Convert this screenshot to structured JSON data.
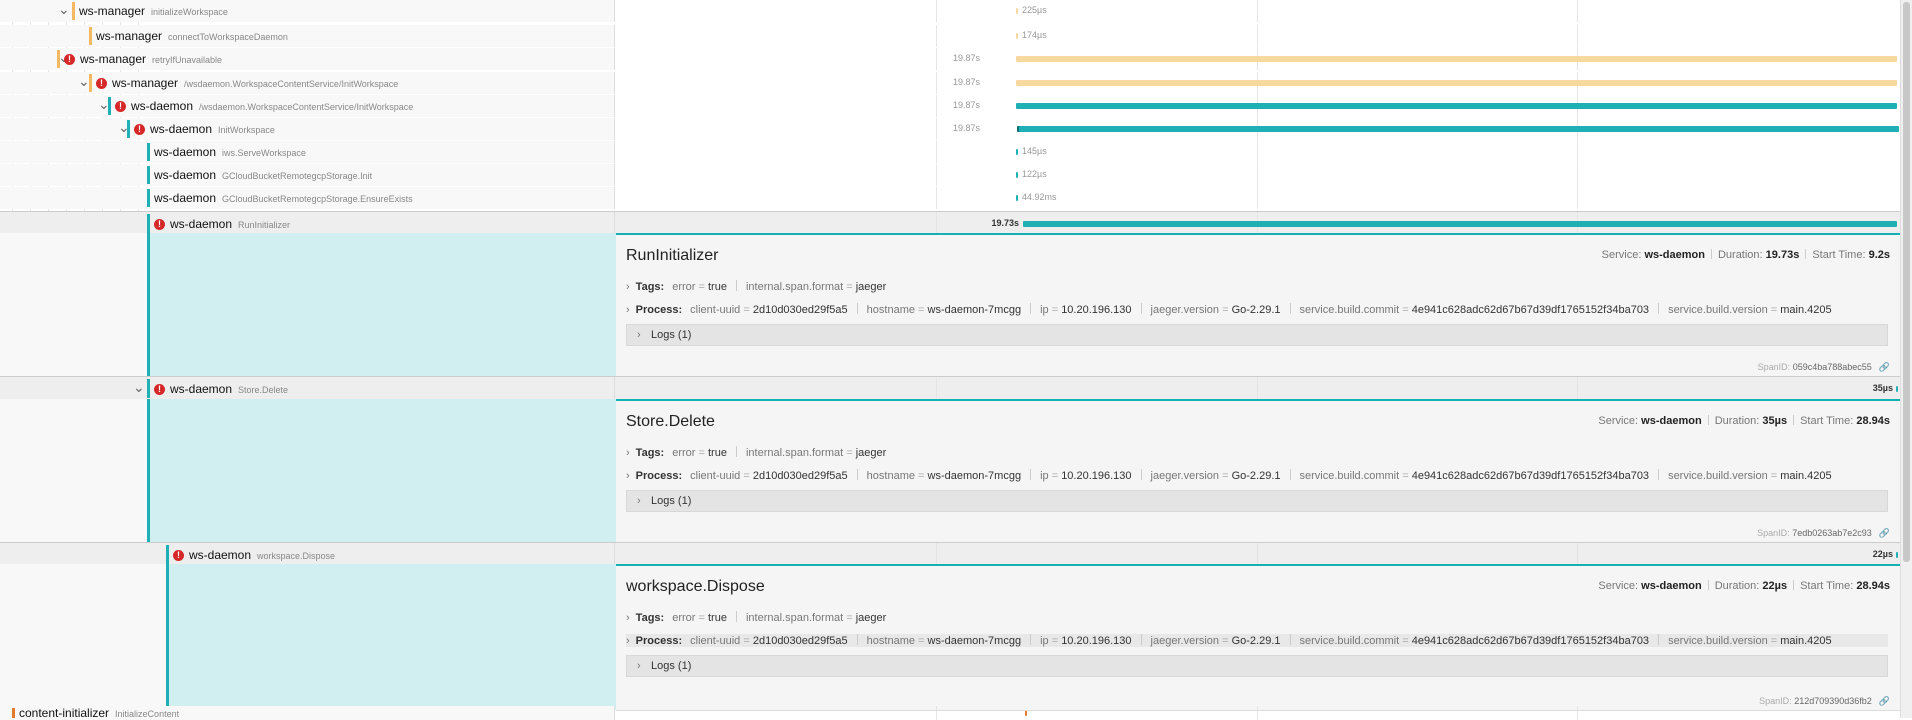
{
  "spans": [
    {
      "service": "ws-manager",
      "operation": "initializeWorkspace",
      "error": false,
      "duration": "225µs"
    },
    {
      "service": "ws-manager",
      "operation": "connectToWorkspaceDaemon",
      "error": false,
      "duration": "174µs"
    },
    {
      "service": "ws-manager",
      "operation": "retryIfUnavailable",
      "error": true,
      "duration": "19.87s"
    },
    {
      "service": "ws-manager",
      "operation": "/wsdaemon.WorkspaceContentService/InitWorkspace",
      "error": true,
      "duration": "19.87s"
    },
    {
      "service": "ws-daemon",
      "operation": "/wsdaemon.WorkspaceContentService/InitWorkspace",
      "error": true,
      "duration": "19.87s"
    },
    {
      "service": "ws-daemon",
      "operation": "InitWorkspace",
      "error": true,
      "duration": "19.87s"
    },
    {
      "service": "ws-daemon",
      "operation": "iws.ServeWorkspace",
      "error": false,
      "duration": "145µs"
    },
    {
      "service": "ws-daemon",
      "operation": "GCloudBucketRemotegcpStorage.Init",
      "error": false,
      "duration": "122µs"
    },
    {
      "service": "ws-daemon",
      "operation": "GCloudBucketRemotegcpStorage.EnsureExists",
      "error": false,
      "duration": "44.92ms"
    },
    {
      "service": "ws-daemon",
      "operation": "RunInitializer",
      "error": true,
      "duration": "19.73s"
    },
    {
      "service": "ws-daemon",
      "operation": "Store.Delete",
      "error": true,
      "duration": "35µs"
    },
    {
      "service": "ws-daemon",
      "operation": "workspace.Dispose",
      "error": true,
      "duration": "22µs"
    },
    {
      "service": "content-initializer",
      "operation": "InitializeContent",
      "error": false,
      "duration": ""
    }
  ],
  "details": [
    {
      "title": "RunInitializer",
      "service_label": "Service:",
      "service": "ws-daemon",
      "duration_label": "Duration:",
      "duration": "19.73s",
      "start_label": "Start Time:",
      "start": "9.2s",
      "span_id_label": "SpanID:",
      "span_id": "059c4ba788abec55",
      "logs_label": "Logs (1)"
    },
    {
      "title": "Store.Delete",
      "service_label": "Service:",
      "service": "ws-daemon",
      "duration_label": "Duration:",
      "duration": "35µs",
      "start_label": "Start Time:",
      "start": "28.94s",
      "span_id_label": "SpanID:",
      "span_id": "7edb0263ab7e2c93",
      "logs_label": "Logs (1)"
    },
    {
      "title": "workspace.Dispose",
      "service_label": "Service:",
      "service": "ws-daemon",
      "duration_label": "Duration:",
      "duration": "22µs",
      "start_label": "Start Time:",
      "start": "28.94s",
      "span_id_label": "SpanID:",
      "span_id": "212d709390d36fb2",
      "logs_label": "Logs (1)"
    }
  ],
  "tags": {
    "label": "Tags:",
    "items": [
      {
        "k": "error",
        "v": "true"
      },
      {
        "k": "internal.span.format",
        "v": "jaeger"
      }
    ]
  },
  "process": {
    "label": "Process:",
    "items": [
      {
        "k": "client-uuid",
        "v": "2d10d030ed29f5a5"
      },
      {
        "k": "hostname",
        "v": "ws-daemon-7mcgg"
      },
      {
        "k": "ip",
        "v": "10.20.196.130"
      },
      {
        "k": "jaeger.version",
        "v": "Go-2.29.1"
      },
      {
        "k": "service.build.commit",
        "v": "4e941c628adc62d67b67d39df1765152f34ba703"
      },
      {
        "k": "service.build.version",
        "v": "main.4205"
      }
    ]
  },
  "colors": {
    "ws_manager": "#f7d9a0",
    "ws_manager_edge": "#f4b860",
    "ws_daemon": "#1fb0b5",
    "content_initializer": "#e07a2e",
    "error": "#d62828",
    "selected_bg": "#d1eff0"
  }
}
